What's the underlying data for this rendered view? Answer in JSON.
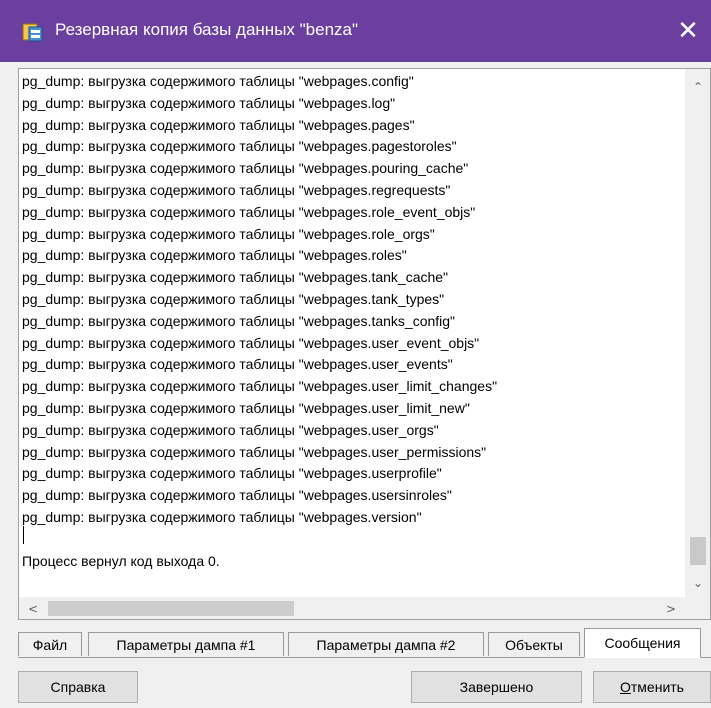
{
  "window": {
    "title": "Резервная копия базы данных \"benza\"",
    "icon": "database-backup-icon",
    "close_glyph": "✕"
  },
  "log": {
    "lines": [
      "pg_dump: выгрузка содержимого таблицы \"webpages.config\"",
      "pg_dump: выгрузка содержимого таблицы \"webpages.log\"",
      "pg_dump: выгрузка содержимого таблицы \"webpages.pages\"",
      "pg_dump: выгрузка содержимого таблицы \"webpages.pagestoroles\"",
      "pg_dump: выгрузка содержимого таблицы \"webpages.pouring_cache\"",
      "pg_dump: выгрузка содержимого таблицы \"webpages.regrequests\"",
      "pg_dump: выгрузка содержимого таблицы \"webpages.role_event_objs\"",
      "pg_dump: выгрузка содержимого таблицы \"webpages.role_orgs\"",
      "pg_dump: выгрузка содержимого таблицы \"webpages.roles\"",
      "pg_dump: выгрузка содержимого таблицы \"webpages.tank_cache\"",
      "pg_dump: выгрузка содержимого таблицы \"webpages.tank_types\"",
      "pg_dump: выгрузка содержимого таблицы \"webpages.tanks_config\"",
      "pg_dump: выгрузка содержимого таблицы \"webpages.user_event_objs\"",
      "pg_dump: выгрузка содержимого таблицы \"webpages.user_events\"",
      "pg_dump: выгрузка содержимого таблицы \"webpages.user_limit_changes\"",
      "pg_dump: выгрузка содержимого таблицы \"webpages.user_limit_new\"",
      "pg_dump: выгрузка содержимого таблицы \"webpages.user_orgs\"",
      "pg_dump: выгрузка содержимого таблицы \"webpages.user_permissions\"",
      "pg_dump: выгрузка содержимого таблицы \"webpages.userprofile\"",
      "pg_dump: выгрузка содержимого таблицы \"webpages.usersinroles\"",
      "pg_dump: выгрузка содержимого таблицы \"webpages.version\""
    ],
    "exit_message": "Процесс вернул код выхода 0."
  },
  "scrollbars": {
    "up_glyph": "⌃",
    "down_glyph": "⌄",
    "left_glyph": "<",
    "right_glyph": ">"
  },
  "tabs": [
    {
      "label": "Файл",
      "active": false
    },
    {
      "label": "Параметры дампа #1",
      "active": false
    },
    {
      "label": "Параметры дампа #2",
      "active": false
    },
    {
      "label": "Объекты",
      "active": false
    },
    {
      "label": "Сообщения",
      "active": true
    }
  ],
  "buttons": {
    "help_label": "Справка",
    "finish_label": "Завершено",
    "cancel_first": "О",
    "cancel_rest": "тменить"
  },
  "colors": {
    "titlebar": "#6b3fa0",
    "window_bg": "#f0f0f0"
  }
}
